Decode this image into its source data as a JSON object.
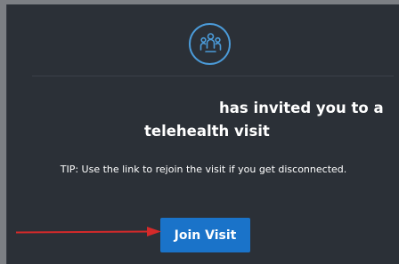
{
  "invite": {
    "logo_icon": "group-people-icon",
    "heading_line1": "has invited you to a",
    "heading_line2": "telehealth visit",
    "tip": "TIP: Use the link to rejoin the visit if you get disconnected.",
    "join_label": "Join Visit"
  },
  "colors": {
    "background": "#2b3037",
    "outer": "#7c7f84",
    "accent": "#1a73c9",
    "logo": "#4b9bd9",
    "arrow": "#d42a2a"
  },
  "annotation": {
    "icon": "red-arrow-icon"
  }
}
